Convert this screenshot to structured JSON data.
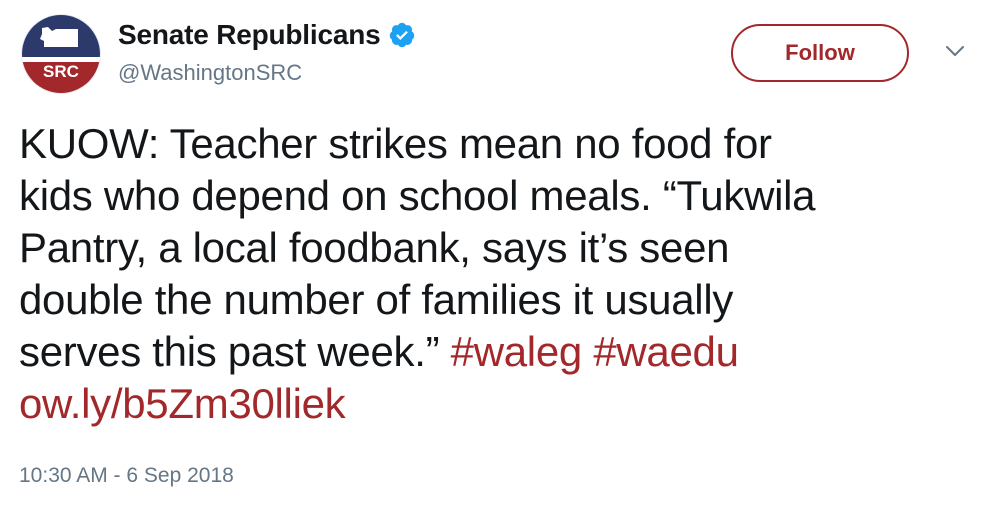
{
  "account": {
    "display_name": "Senate Republicans",
    "handle": "@WashingtonSRC",
    "verified": true,
    "avatar_text": "SRC",
    "brand_color": "#a3282b",
    "navy_color": "#2b3a6b"
  },
  "actions": {
    "follow_label": "Follow",
    "menu_icon": "chevron-down-icon"
  },
  "tweet": {
    "lines": {
      "l1": "KUOW: Teacher strikes mean no food for",
      "l2": "kids who depend on school meals. “Tukwila",
      "l3": "Pantry, a local foodbank, says it’s seen",
      "l4": "double the number of families it usually",
      "l5_text": "serves this past week.” ",
      "l6_link": "ow.ly/b5Zm30lliek"
    },
    "hashtags": [
      "#waleg",
      "#waedu"
    ],
    "timestamp": "10:30 AM - 6 Sep 2018"
  }
}
